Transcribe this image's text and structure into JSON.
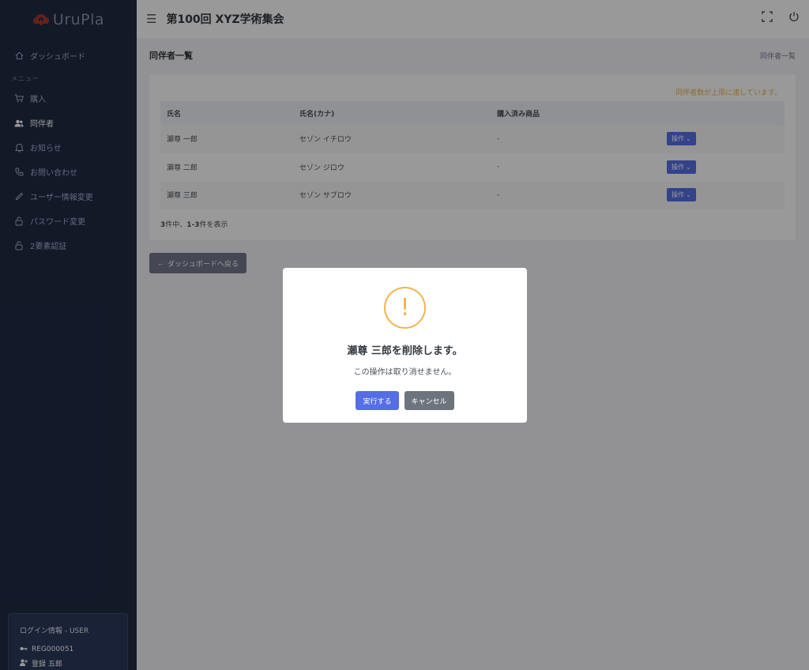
{
  "sidebar": {
    "logo_text": "UruPla",
    "menu_title": "メニュー",
    "items": [
      {
        "label": "ダッシュボード",
        "icon": "home-icon"
      },
      {
        "label": "購入",
        "icon": "cart-icon"
      },
      {
        "label": "同伴者",
        "icon": "users-icon",
        "active": true
      },
      {
        "label": "お知らせ",
        "icon": "bell-icon"
      },
      {
        "label": "お問い合わせ",
        "icon": "phone-icon"
      },
      {
        "label": "ユーザー情報変更",
        "icon": "pencil-icon"
      },
      {
        "label": "パスワード変更",
        "icon": "lock-icon"
      },
      {
        "label": "2要素認証",
        "icon": "lock-icon"
      }
    ],
    "login": {
      "title": "ログイン情報 - USER",
      "id": "REG000051",
      "name": "登録 五郎"
    }
  },
  "header": {
    "title": "第100回 XYZ学術集会"
  },
  "main": {
    "page_title": "同伴者一覧",
    "breadcrumb": "同伴者一覧",
    "notice": "同伴者数が上限に達しています。",
    "columns": [
      "氏名",
      "氏名(カナ)",
      "購入済み商品",
      ""
    ],
    "rows": [
      {
        "name": "瀬尊 一郎",
        "kana": "セゾン イチロウ",
        "product": "-",
        "action": "操作"
      },
      {
        "name": "瀬尊 二郎",
        "kana": "セゾン ジロウ",
        "product": "-",
        "action": "操作"
      },
      {
        "name": "瀬尊 三郎",
        "kana": "セゾン サブロウ",
        "product": "-",
        "action": "操作"
      }
    ],
    "count": {
      "total": "3",
      "mid": "件中、",
      "range": "1-3",
      "suffix": "件を表示"
    },
    "back_button": "ダッシュボードへ戻る"
  },
  "modal": {
    "icon": "!",
    "title": "瀬尊 三郎を削除します。",
    "text": "この操作は取り消せません。",
    "confirm": "実行する",
    "cancel": "キャンセル"
  },
  "colors": {
    "primary": "#556ee6",
    "warning": "#f1b44c",
    "sidebar": "#1e2a42"
  }
}
